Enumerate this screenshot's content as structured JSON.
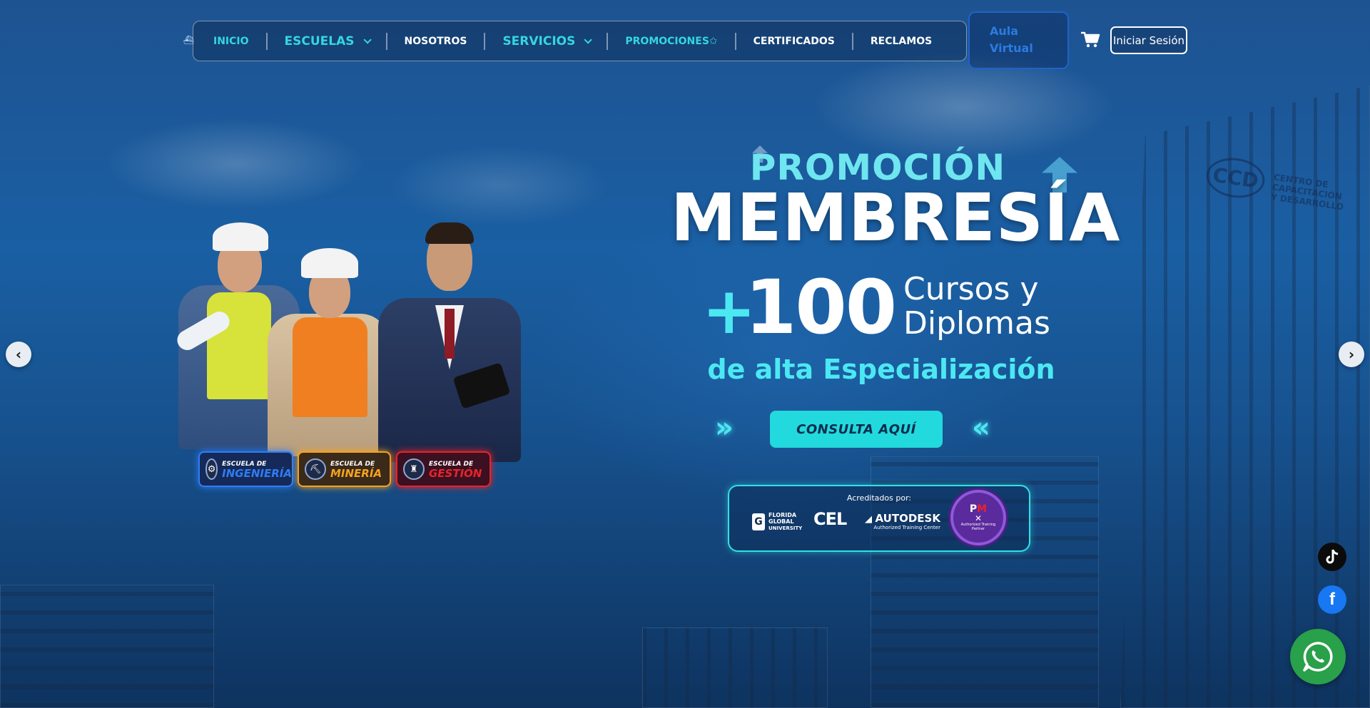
{
  "nav": {
    "items": [
      {
        "label": "INICIO",
        "dropdown": false
      },
      {
        "label": "ESCUELAS",
        "dropdown": true
      },
      {
        "label": "NOSOTROS",
        "dropdown": false
      },
      {
        "label": "SERVICIOS",
        "dropdown": true
      },
      {
        "label": "PROMOCIONES✩",
        "dropdown": false
      },
      {
        "label": "CERTIFICADOS",
        "dropdown": false
      },
      {
        "label": "RECLAMOS",
        "dropdown": false
      }
    ],
    "aula_line1": "Aula",
    "aula_line2": "Virtual",
    "login_label": "Iniciar Sesión",
    "cart_icon": "cart-icon"
  },
  "hero": {
    "promo": "PROMOCIÓN",
    "title": "MEMBRESÍA",
    "plus": "+",
    "count": "100",
    "count_line1": "Cursos y",
    "count_line2": "Diplomas",
    "subtitle": "de alta Especialización",
    "cta_label": "CONSULTA AQUÍ",
    "accreditation_title": "Acreditados por:",
    "accreditors": {
      "ffgu_line1": "FLORIDA",
      "ffgu_line2": "GLOBAL",
      "ffgu_line3": "UNIVERSITY",
      "cel": "CEL",
      "autodesk": "AUTODESK",
      "autodesk_sub": "Authorized Training Center",
      "pmi_sub": "Authorized Training Partner"
    }
  },
  "schools": [
    {
      "prefix": "ESCUELA DE",
      "name": "INGENIERÍA",
      "color": "#2f7cf5"
    },
    {
      "prefix": "ESCUELA DE",
      "name": "MINERÍA",
      "color": "#f5a21d"
    },
    {
      "prefix": "ESCUELA DE",
      "name": "GESTIÓN",
      "color": "#e8232a"
    }
  ],
  "building_sign": {
    "logo": "CCD",
    "line1": "CENTRO DE",
    "line2": "CAPACITACIÓN",
    "line3": "Y DESARROLLO"
  },
  "carousel": {
    "prev_icon": "‹",
    "next_icon": "›"
  },
  "social": {
    "tiktok_icon": "tiktok-icon",
    "facebook_icon": "facebook-icon",
    "whatsapp_icon": "whatsapp-icon"
  },
  "colors": {
    "accent": "#35d6e0",
    "cta": "#22d9dd",
    "aula": "#2b7be0"
  }
}
